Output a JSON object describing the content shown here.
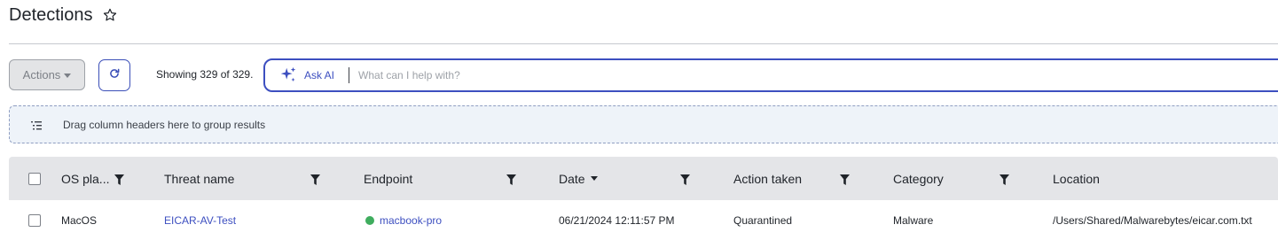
{
  "page": {
    "title": "Detections"
  },
  "toolbar": {
    "actions_label": "Actions",
    "showing_text": "Showing 329 of 329.",
    "ask_ai_label": "Ask AI",
    "ask_placeholder": "What can I help with?"
  },
  "group_bar": {
    "text": "Drag column headers here to group results"
  },
  "table": {
    "columns": [
      {
        "label": "OS pla...",
        "filterable": true
      },
      {
        "label": "Threat name",
        "filterable": true
      },
      {
        "label": "Endpoint",
        "filterable": true
      },
      {
        "label": "Date",
        "filterable": true,
        "sorted": "desc"
      },
      {
        "label": "Action taken",
        "filterable": true
      },
      {
        "label": "Category",
        "filterable": true
      },
      {
        "label": "Location",
        "filterable": false
      }
    ],
    "rows": [
      {
        "os": "MacOS",
        "threat_name": "EICAR-AV-Test",
        "endpoint": "macbook-pro",
        "endpoint_status": "online",
        "date": "06/21/2024 12:11:57 PM",
        "action_taken": "Quarantined",
        "category": "Malware",
        "location": "/Users/Shared/Malwarebytes/eicar.com.txt"
      }
    ]
  },
  "colors": {
    "accent": "#3d4fc0",
    "header_bg": "#e4e5e8",
    "group_bar_bg": "#eef3f9",
    "online_status": "#3fad5e"
  },
  "icons": [
    "star-icon",
    "caret-down-icon",
    "refresh-icon",
    "sparkle-icon",
    "group-list-icon",
    "filter-icon",
    "sort-desc-icon",
    "status-dot-icon"
  ]
}
